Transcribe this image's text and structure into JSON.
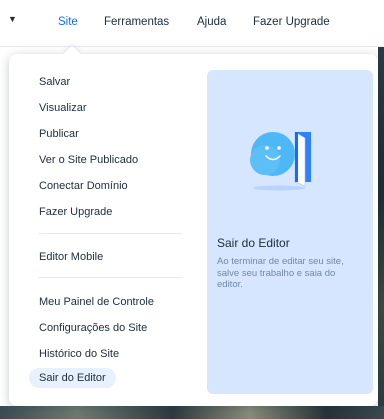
{
  "topbar": {
    "items": [
      {
        "label": "Site",
        "active": true
      },
      {
        "label": "Ferramentas",
        "active": false
      },
      {
        "label": "Ajuda",
        "active": false
      },
      {
        "label": "Fazer Upgrade",
        "active": false
      }
    ]
  },
  "dropdown": {
    "group1": [
      "Salvar",
      "Visualizar",
      "Publicar",
      "Ver o Site Publicado",
      "Conectar Domínio",
      "Fazer Upgrade"
    ],
    "group2": [
      "Editor Mobile"
    ],
    "group3": [
      "Meu Painel de Controle",
      "Configurações do Site",
      "Histórico do Site",
      "Sair do Editor"
    ],
    "highlighted_item": "Sair do Editor"
  },
  "info_panel": {
    "title": "Sair do Editor",
    "description": "Ao terminar de editar seu site, salve seu trabalho e saia do editor."
  },
  "colors": {
    "accent": "#116dff",
    "text": "#20303c",
    "panel_bg": "#d6e6fe",
    "highlight_bg": "#e7f0ff",
    "illustration_blue": "#4eb7f5",
    "door_blue": "#116dff"
  },
  "icons": [
    "chevron-down-icon",
    "smiley-cloud-icon",
    "open-door-icon"
  ]
}
